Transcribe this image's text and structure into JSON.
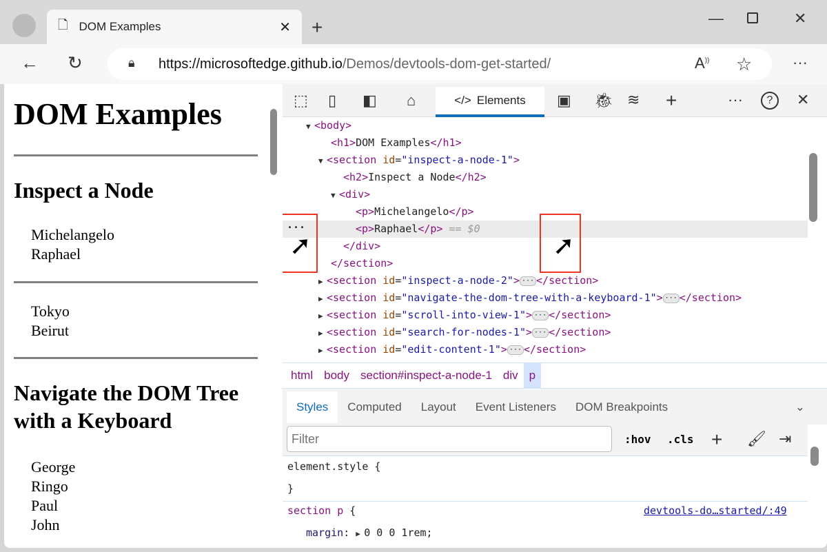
{
  "browser": {
    "tab_title": "DOM Examples",
    "url_domain": "https://microsoftedge.github.io",
    "url_path": "/Demos/devtools-dom-get-started/"
  },
  "page": {
    "title": "DOM Examples",
    "section1_heading": "Inspect a Node",
    "section1_items": [
      "Michelangelo",
      "Raphael"
    ],
    "section2_items": [
      "Tokyo",
      "Beirut"
    ],
    "section3_heading": "Navigate the DOM Tree with a Keyboard",
    "section3_items": [
      "George",
      "Ringo",
      "Paul",
      "John"
    ]
  },
  "devtools": {
    "active_tab": "Elements",
    "dom": {
      "body": "body",
      "h1_text": "DOM Examples",
      "section1_id": "inspect-a-node-1",
      "h2_text": "Inspect a Node",
      "p1": "Michelangelo",
      "p2": "Raphael",
      "selected_marker": "== $0",
      "collapsed_sections": [
        "inspect-a-node-2",
        "navigate-the-dom-tree-with-a-keyboard-1",
        "scroll-into-view-1",
        "search-for-nodes-1",
        "edit-content-1"
      ]
    },
    "breadcrumbs": [
      "html",
      "body",
      "section#inspect-a-node-1",
      "div",
      "p"
    ],
    "panel_tabs": [
      "Styles",
      "Computed",
      "Layout",
      "Event Listeners",
      "DOM Breakpoints"
    ],
    "filter_placeholder": "Filter",
    "hov": ":hov",
    "cls": ".cls",
    "rules": {
      "element_style": "element.style {",
      "close": "}",
      "selector": "section p",
      "source": "devtools-do…started/:49",
      "prop": "margin",
      "value": "0 0 0 1rem;"
    }
  }
}
